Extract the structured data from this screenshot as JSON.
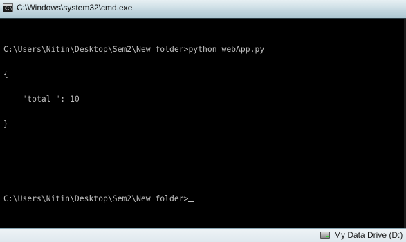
{
  "window": {
    "title": "C:\\Windows\\system32\\cmd.exe",
    "title_icon": "cmd-icon"
  },
  "console": {
    "lines": [
      "C:\\Users\\Nitin\\Desktop\\Sem2\\New folder>python webApp.py",
      "{",
      "    \"total \": 10",
      "}",
      "",
      "",
      "C:\\Users\\Nitin\\Desktop\\Sem2\\New folder>"
    ],
    "text_color": "#c0c0c0",
    "background_color": "#000000"
  },
  "taskbar": {
    "drive_label": "My Data Drive (D:)",
    "drive_icon": "hard-drive-icon"
  }
}
